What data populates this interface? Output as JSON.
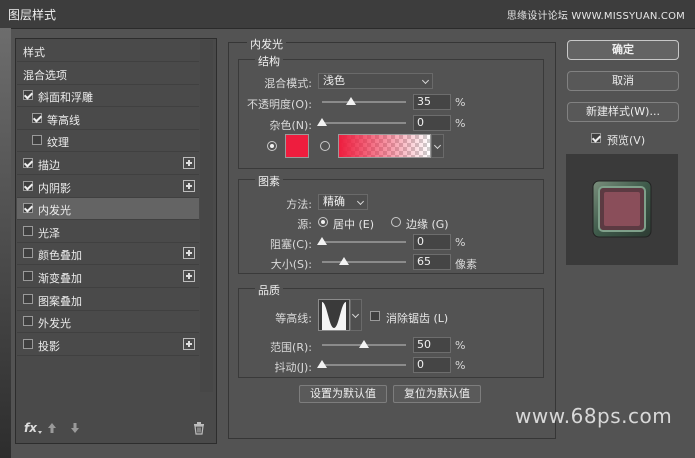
{
  "window": {
    "title": "图层样式",
    "site_watermark": "思缘设计论坛 WWW.MISSYUAN.COM"
  },
  "sidebar": {
    "items": [
      {
        "label": "样式",
        "checkbox": false,
        "checked": false,
        "indent": false,
        "plus": false,
        "active": false
      },
      {
        "label": "混合选项",
        "checkbox": false,
        "checked": false,
        "indent": false,
        "plus": false,
        "active": false
      },
      {
        "label": "斜面和浮雕",
        "checkbox": true,
        "checked": true,
        "indent": false,
        "plus": false,
        "active": false
      },
      {
        "label": "等高线",
        "checkbox": true,
        "checked": true,
        "indent": true,
        "plus": false,
        "active": false
      },
      {
        "label": "纹理",
        "checkbox": true,
        "checked": false,
        "indent": true,
        "plus": false,
        "active": false
      },
      {
        "label": "描边",
        "checkbox": true,
        "checked": true,
        "indent": false,
        "plus": true,
        "active": false
      },
      {
        "label": "内阴影",
        "checkbox": true,
        "checked": true,
        "indent": false,
        "plus": true,
        "active": false
      },
      {
        "label": "内发光",
        "checkbox": true,
        "checked": true,
        "indent": false,
        "plus": false,
        "active": true
      },
      {
        "label": "光泽",
        "checkbox": true,
        "checked": false,
        "indent": false,
        "plus": false,
        "active": false
      },
      {
        "label": "颜色叠加",
        "checkbox": true,
        "checked": false,
        "indent": false,
        "plus": true,
        "active": false
      },
      {
        "label": "渐变叠加",
        "checkbox": true,
        "checked": false,
        "indent": false,
        "plus": true,
        "active": false
      },
      {
        "label": "图案叠加",
        "checkbox": true,
        "checked": false,
        "indent": false,
        "plus": false,
        "active": false
      },
      {
        "label": "外发光",
        "checkbox": true,
        "checked": false,
        "indent": false,
        "plus": false,
        "active": false
      },
      {
        "label": "投影",
        "checkbox": true,
        "checked": false,
        "indent": false,
        "plus": true,
        "active": false
      }
    ],
    "bottom": {
      "fx_label": "fx"
    }
  },
  "inner_glow": {
    "panel_title": "内发光",
    "structure": {
      "title": "结构",
      "blend_mode_label": "混合模式:",
      "blend_mode_value": "浅色",
      "opacity_label": "不透明度(O):",
      "opacity_value": "35",
      "opacity_percent": 35,
      "opacity_unit": "%",
      "noise_label": "杂色(N):",
      "noise_value": "0",
      "noise_percent": 0,
      "noise_unit": "%",
      "glow_color": "#ee1d3e"
    },
    "elements": {
      "title": "图素",
      "technique_label": "方法:",
      "technique_value": "精确",
      "source_label": "源:",
      "source_center": "居中 (E)",
      "source_edge": "边缘 (G)",
      "choke_label": "阻塞(C):",
      "choke_value": "0",
      "choke_percent": 0,
      "choke_unit": "%",
      "size_label": "大小(S):",
      "size_value": "65",
      "size_fraction": 0.26,
      "size_unit": "像素"
    },
    "quality": {
      "title": "品质",
      "contour_label": "等高线:",
      "antialias_label": "消除锯齿 (L)",
      "range_label": "范围(R):",
      "range_value": "50",
      "range_percent": 50,
      "range_unit": "%",
      "jitter_label": "抖动(J):",
      "jitter_value": "0",
      "jitter_percent": 0,
      "jitter_unit": "%"
    },
    "buttons": {
      "make_default": "设置为默认值",
      "reset_default": "复位为默认值"
    }
  },
  "actions": {
    "ok": "确定",
    "cancel": "取消",
    "new_style": "新建样式(W)...",
    "preview_label": "预览(V)"
  },
  "footer_watermark": "www.68ps.com"
}
